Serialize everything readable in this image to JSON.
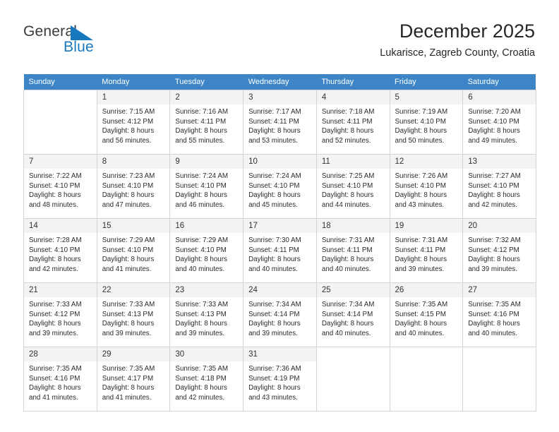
{
  "logo": {
    "word_one": "General",
    "word_two": "Blue",
    "triangle_icon": "blue-triangle-icon",
    "brand_color": "#1878be"
  },
  "header": {
    "title": "December 2025",
    "subtitle": "Lukarisce, Zagreb County, Croatia"
  },
  "calendar": {
    "header_bg": "#3d85c6",
    "header_text_color": "#ffffff",
    "daynum_bg": "#f3f3f3",
    "grid_line_color": "#d4d4d4",
    "weekday_headers": [
      "Sunday",
      "Monday",
      "Tuesday",
      "Wednesday",
      "Thursday",
      "Friday",
      "Saturday"
    ],
    "weeks": [
      [
        {
          "day": "",
          "lines": []
        },
        {
          "day": "1",
          "lines": [
            "Sunrise: 7:15 AM",
            "Sunset: 4:12 PM",
            "Daylight: 8 hours",
            "and 56 minutes."
          ]
        },
        {
          "day": "2",
          "lines": [
            "Sunrise: 7:16 AM",
            "Sunset: 4:11 PM",
            "Daylight: 8 hours",
            "and 55 minutes."
          ]
        },
        {
          "day": "3",
          "lines": [
            "Sunrise: 7:17 AM",
            "Sunset: 4:11 PM",
            "Daylight: 8 hours",
            "and 53 minutes."
          ]
        },
        {
          "day": "4",
          "lines": [
            "Sunrise: 7:18 AM",
            "Sunset: 4:11 PM",
            "Daylight: 8 hours",
            "and 52 minutes."
          ]
        },
        {
          "day": "5",
          "lines": [
            "Sunrise: 7:19 AM",
            "Sunset: 4:10 PM",
            "Daylight: 8 hours",
            "and 50 minutes."
          ]
        },
        {
          "day": "6",
          "lines": [
            "Sunrise: 7:20 AM",
            "Sunset: 4:10 PM",
            "Daylight: 8 hours",
            "and 49 minutes."
          ]
        }
      ],
      [
        {
          "day": "7",
          "lines": [
            "Sunrise: 7:22 AM",
            "Sunset: 4:10 PM",
            "Daylight: 8 hours",
            "and 48 minutes."
          ]
        },
        {
          "day": "8",
          "lines": [
            "Sunrise: 7:23 AM",
            "Sunset: 4:10 PM",
            "Daylight: 8 hours",
            "and 47 minutes."
          ]
        },
        {
          "day": "9",
          "lines": [
            "Sunrise: 7:24 AM",
            "Sunset: 4:10 PM",
            "Daylight: 8 hours",
            "and 46 minutes."
          ]
        },
        {
          "day": "10",
          "lines": [
            "Sunrise: 7:24 AM",
            "Sunset: 4:10 PM",
            "Daylight: 8 hours",
            "and 45 minutes."
          ]
        },
        {
          "day": "11",
          "lines": [
            "Sunrise: 7:25 AM",
            "Sunset: 4:10 PM",
            "Daylight: 8 hours",
            "and 44 minutes."
          ]
        },
        {
          "day": "12",
          "lines": [
            "Sunrise: 7:26 AM",
            "Sunset: 4:10 PM",
            "Daylight: 8 hours",
            "and 43 minutes."
          ]
        },
        {
          "day": "13",
          "lines": [
            "Sunrise: 7:27 AM",
            "Sunset: 4:10 PM",
            "Daylight: 8 hours",
            "and 42 minutes."
          ]
        }
      ],
      [
        {
          "day": "14",
          "lines": [
            "Sunrise: 7:28 AM",
            "Sunset: 4:10 PM",
            "Daylight: 8 hours",
            "and 42 minutes."
          ]
        },
        {
          "day": "15",
          "lines": [
            "Sunrise: 7:29 AM",
            "Sunset: 4:10 PM",
            "Daylight: 8 hours",
            "and 41 minutes."
          ]
        },
        {
          "day": "16",
          "lines": [
            "Sunrise: 7:29 AM",
            "Sunset: 4:10 PM",
            "Daylight: 8 hours",
            "and 40 minutes."
          ]
        },
        {
          "day": "17",
          "lines": [
            "Sunrise: 7:30 AM",
            "Sunset: 4:11 PM",
            "Daylight: 8 hours",
            "and 40 minutes."
          ]
        },
        {
          "day": "18",
          "lines": [
            "Sunrise: 7:31 AM",
            "Sunset: 4:11 PM",
            "Daylight: 8 hours",
            "and 40 minutes."
          ]
        },
        {
          "day": "19",
          "lines": [
            "Sunrise: 7:31 AM",
            "Sunset: 4:11 PM",
            "Daylight: 8 hours",
            "and 39 minutes."
          ]
        },
        {
          "day": "20",
          "lines": [
            "Sunrise: 7:32 AM",
            "Sunset: 4:12 PM",
            "Daylight: 8 hours",
            "and 39 minutes."
          ]
        }
      ],
      [
        {
          "day": "21",
          "lines": [
            "Sunrise: 7:33 AM",
            "Sunset: 4:12 PM",
            "Daylight: 8 hours",
            "and 39 minutes."
          ]
        },
        {
          "day": "22",
          "lines": [
            "Sunrise: 7:33 AM",
            "Sunset: 4:13 PM",
            "Daylight: 8 hours",
            "and 39 minutes."
          ]
        },
        {
          "day": "23",
          "lines": [
            "Sunrise: 7:33 AM",
            "Sunset: 4:13 PM",
            "Daylight: 8 hours",
            "and 39 minutes."
          ]
        },
        {
          "day": "24",
          "lines": [
            "Sunrise: 7:34 AM",
            "Sunset: 4:14 PM",
            "Daylight: 8 hours",
            "and 39 minutes."
          ]
        },
        {
          "day": "25",
          "lines": [
            "Sunrise: 7:34 AM",
            "Sunset: 4:14 PM",
            "Daylight: 8 hours",
            "and 40 minutes."
          ]
        },
        {
          "day": "26",
          "lines": [
            "Sunrise: 7:35 AM",
            "Sunset: 4:15 PM",
            "Daylight: 8 hours",
            "and 40 minutes."
          ]
        },
        {
          "day": "27",
          "lines": [
            "Sunrise: 7:35 AM",
            "Sunset: 4:16 PM",
            "Daylight: 8 hours",
            "and 40 minutes."
          ]
        }
      ],
      [
        {
          "day": "28",
          "lines": [
            "Sunrise: 7:35 AM",
            "Sunset: 4:16 PM",
            "Daylight: 8 hours",
            "and 41 minutes."
          ]
        },
        {
          "day": "29",
          "lines": [
            "Sunrise: 7:35 AM",
            "Sunset: 4:17 PM",
            "Daylight: 8 hours",
            "and 41 minutes."
          ]
        },
        {
          "day": "30",
          "lines": [
            "Sunrise: 7:35 AM",
            "Sunset: 4:18 PM",
            "Daylight: 8 hours",
            "and 42 minutes."
          ]
        },
        {
          "day": "31",
          "lines": [
            "Sunrise: 7:36 AM",
            "Sunset: 4:19 PM",
            "Daylight: 8 hours",
            "and 43 minutes."
          ]
        },
        {
          "day": "",
          "lines": []
        },
        {
          "day": "",
          "lines": []
        },
        {
          "day": "",
          "lines": []
        }
      ]
    ]
  }
}
